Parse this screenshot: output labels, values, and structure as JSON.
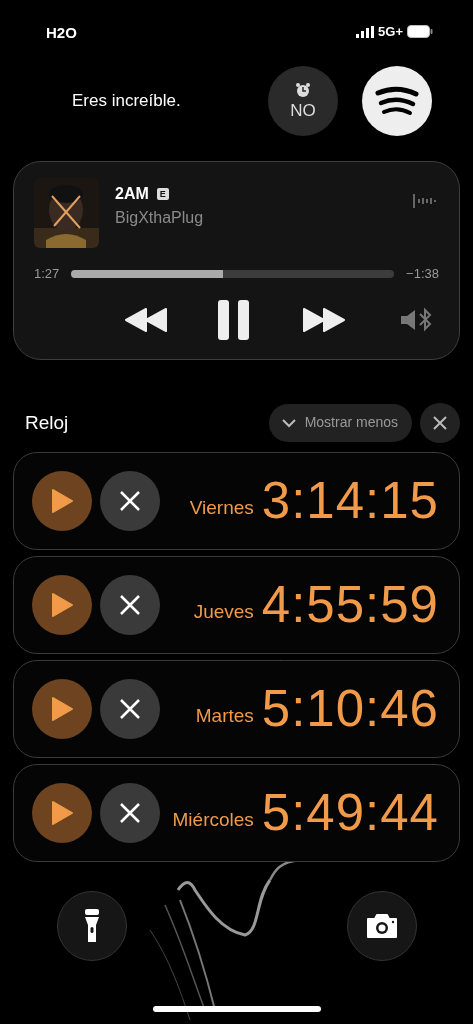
{
  "status_bar": {
    "carrier": "H2O",
    "network": "5G+"
  },
  "widgets": {
    "message": "Eres increíble.",
    "alarm": {
      "label": "NO"
    }
  },
  "now_playing": {
    "title": "2AM",
    "badge": "E",
    "artist": "BigXthaPlug",
    "elapsed": "1:27",
    "remaining": "−1:38",
    "level": 0.47
  },
  "timers": {
    "title": "Reloj",
    "collapse_button": "Mostrar menos",
    "items": [
      {
        "day": "Viernes",
        "time": "3:14:15"
      },
      {
        "day": "Jueves",
        "time": "4:55:59"
      },
      {
        "day": "Martes",
        "time": "5:10:46"
      },
      {
        "day": "Miércoles",
        "time": "5:49:44"
      }
    ]
  }
}
